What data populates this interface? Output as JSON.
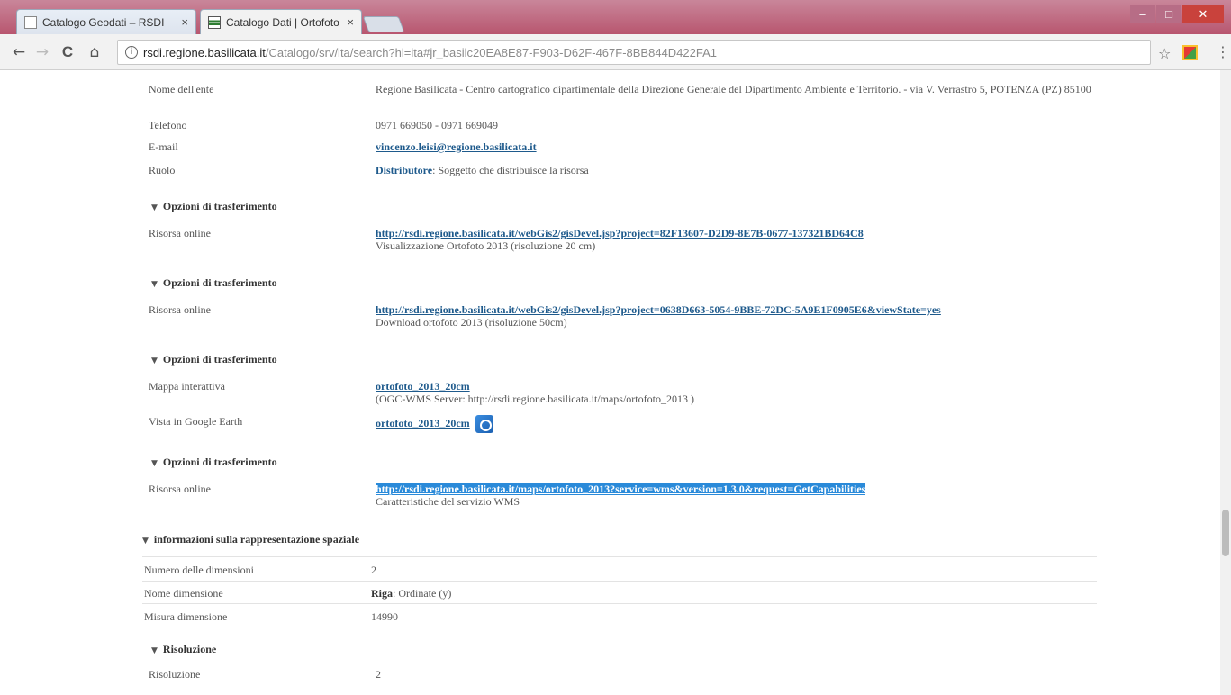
{
  "tabs": [
    {
      "title": "Catalogo Geodati – RSDI",
      "close": "×"
    },
    {
      "title": "Catalogo Dati | Ortofoto",
      "close": "×"
    }
  ],
  "window_controls": {
    "minimize": "–",
    "maximize": "□",
    "close": "✕"
  },
  "toolbar": {
    "back": "←",
    "forward": "→",
    "reload": "C",
    "home": "⌂",
    "info": "i",
    "url_host": "rsdi.regione.basilicata.it",
    "url_path": "/Catalogo/srv/ita/search?hl=ita#jr_basilc20EA8E87-F903-D62F-467F-8BB844D422FA1",
    "star": "☆",
    "menu": "⋮"
  },
  "contact": {
    "nome_label": "Nome dell'ente",
    "nome_value": "Regione Basilicata - Centro cartografico dipartimentale della Direzione Generale del Dipartimento Ambiente e Territorio. - via V. Verrastro 5, POTENZA (PZ) 85100",
    "telefono_label": "Telefono",
    "telefono_value": "0971 669050 - 0971 669049",
    "email_label": "E-mail",
    "email_value": "vincenzo.leisi@regione.basilicata.it",
    "ruolo_label": "Ruolo",
    "ruolo_bold": "Distributore",
    "ruolo_text": ": Soggetto che distribuisce la risorsa"
  },
  "transfer_1": {
    "heading": "Opzioni di trasferimento",
    "label": "Risorsa online",
    "link": "http://rsdi.regione.basilicata.it/webGis2/gisDevel.jsp?project=82F13607-D2D9-8E7B-0677-137321BD64C8",
    "desc": "Visualizzazione Ortofoto 2013 (risoluzione 20 cm)"
  },
  "transfer_2": {
    "heading": "Opzioni di trasferimento",
    "label": "Risorsa online",
    "link": "http://rsdi.regione.basilicata.it/webGis2/gisDevel.jsp?project=0638D663-5054-9BBE-72DC-5A9E1F0905E6&viewState=yes",
    "desc": "Download ortofoto 2013 (risoluzione 50cm)"
  },
  "transfer_3": {
    "heading": "Opzioni di trasferimento",
    "map_label": "Mappa interattiva",
    "map_link": "ortofoto_2013_20cm",
    "map_desc": "(OGC-WMS Server: http://rsdi.regione.basilicata.it/maps/ortofoto_2013 )",
    "earth_label": "Vista in Google Earth",
    "earth_link": "ortofoto_2013_20cm"
  },
  "transfer_4": {
    "heading": "Opzioni di trasferimento",
    "label": "Risorsa online",
    "link": "http://rsdi.regione.basilicata.it/maps/ortofoto_2013?service=wms&version=1.3.0&request=GetCapabilities",
    "desc": "Caratteristiche del servizio WMS"
  },
  "spatial": {
    "heading": "informazioni sulla rappresentazione spaziale",
    "num_dim_label": "Numero delle dimensioni",
    "num_dim_value": "2",
    "dim_name_label": "Nome dimensione",
    "dim_name_bold": "Riga",
    "dim_name_text": ": Ordinate (y)",
    "dim_size_label": "Misura dimensione",
    "dim_size_value": "14990"
  },
  "resolution": {
    "heading": "Risoluzione",
    "label": "Risoluzione",
    "value": "2"
  },
  "caret": "▼"
}
